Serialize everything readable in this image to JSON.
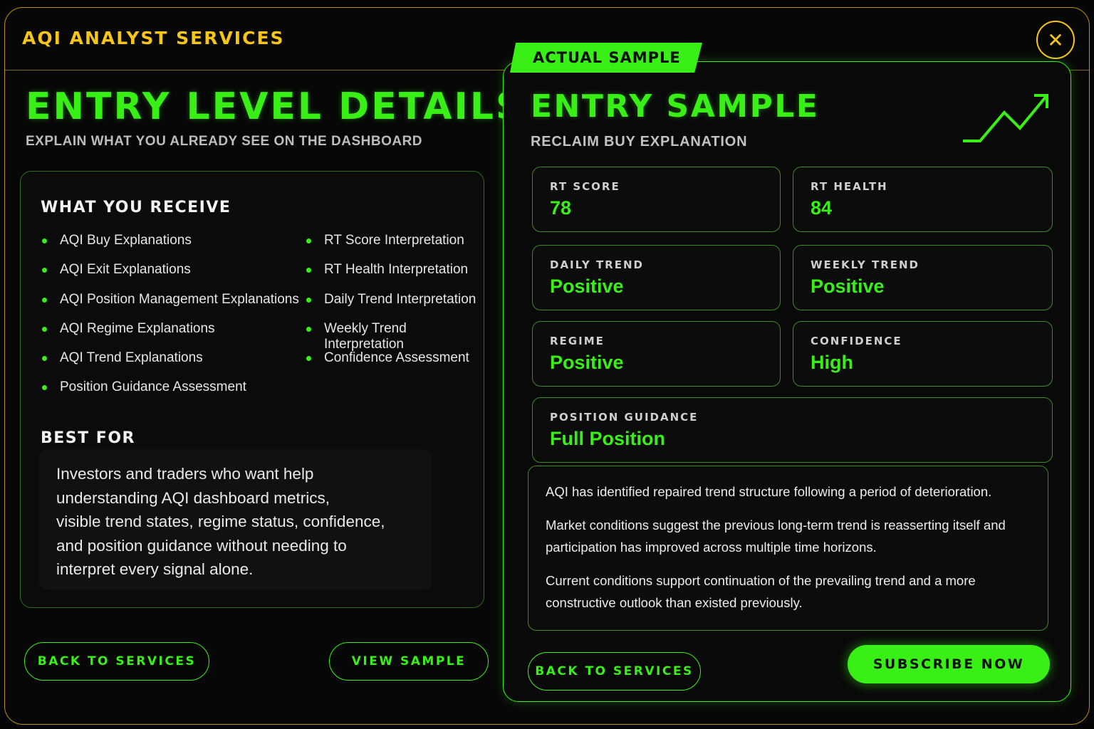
{
  "header": {
    "brand": "AQI ANALYST SERVICES",
    "close_symbol": "✕",
    "close_icon": "close-icon"
  },
  "left": {
    "title": "ENTRY LEVEL DETAILS",
    "subtitle": "EXPLAIN WHAT YOU ALREADY SEE ON THE DASHBOARD",
    "receive_heading": "WHAT YOU RECEIVE",
    "receive_col1": [
      "AQI Buy Explanations",
      "AQI Exit Explanations",
      "AQI Position Management Explanations",
      "AQI Regime Explanations",
      "AQI Trend Explanations",
      "Position Guidance Assessment"
    ],
    "receive_col2": [
      "RT Score Interpretation",
      "RT Health Interpretation",
      "Daily Trend Interpretation",
      "Weekly Trend Interpretation",
      "Confidence Assessment"
    ],
    "bestfor_heading": "BEST FOR",
    "bestfor_lines": [
      "Investors and traders who want help",
      "understanding AQI dashboard metrics,",
      "visible trend states, regime status, confidence,",
      "and position guidance without needing to",
      "interpret every signal alone."
    ],
    "back_button": "BACK TO SERVICES",
    "view_sample_button": "VIEW SAMPLE"
  },
  "sample": {
    "tab_label": "ACTUAL SAMPLE",
    "title": "ENTRY SAMPLE",
    "subtitle": "RECLAIM BUY EXPLANATION",
    "trend_icon": "trending-up-icon",
    "metrics": {
      "rt_score": {
        "label": "RT SCORE",
        "value": "78"
      },
      "rt_health": {
        "label": "RT HEALTH",
        "value": "84"
      },
      "daily_trend": {
        "label": "DAILY TREND",
        "value": "Positive"
      },
      "weekly_trend": {
        "label": "WEEKLY TREND",
        "value": "Positive"
      },
      "regime": {
        "label": "REGIME",
        "value": "Positive"
      },
      "confidence": {
        "label": "CONFIDENCE",
        "value": "High"
      },
      "position_guidance": {
        "label": "POSITION GUIDANCE",
        "value": "Full Position"
      }
    },
    "paragraphs": [
      "AQI has identified repaired trend structure following a period of deterioration.",
      "Market conditions suggest the previous long-term trend is reasserting itself and participation has improved across multiple time horizons.",
      "Current conditions support continuation of the prevailing trend and a more constructive outlook than existed previously."
    ],
    "back_button": "BACK TO SERVICES",
    "subscribe_button": "SUBSCRIBE NOW"
  },
  "colors": {
    "accent_green": "#39f016",
    "brand_yellow": "#f5c518",
    "background": "#070707"
  }
}
